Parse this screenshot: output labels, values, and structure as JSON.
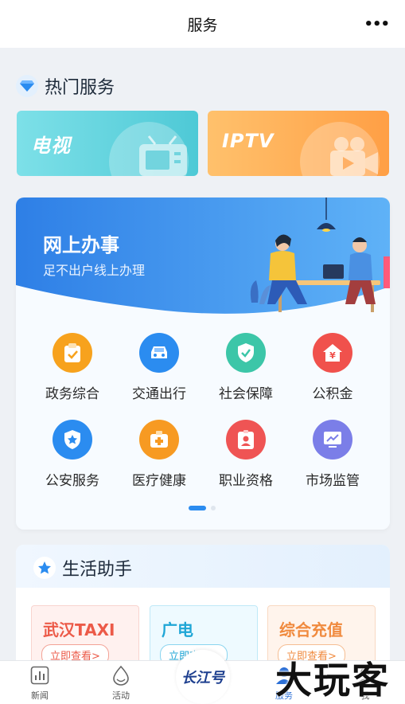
{
  "header": {
    "title": "服务",
    "more": "•••"
  },
  "hot": {
    "title": "热门服务",
    "cards": [
      {
        "label": "电视",
        "color": "#4ec9d6"
      },
      {
        "label": "IPTV",
        "color": "#ff9f45"
      }
    ]
  },
  "online": {
    "title": "网上办事",
    "subtitle": "足不出户线上办理",
    "items": [
      {
        "label": "政务综合",
        "icon": "clipboard-check-icon",
        "color": "#f7a21d"
      },
      {
        "label": "交通出行",
        "icon": "car-icon",
        "color": "#2b8cf0"
      },
      {
        "label": "社会保障",
        "icon": "shield-check-icon",
        "color": "#3cc6a8"
      },
      {
        "label": "公积金",
        "icon": "house-yen-icon",
        "color": "#f0514c"
      },
      {
        "label": "公安服务",
        "icon": "police-badge-icon",
        "color": "#2b8cf0"
      },
      {
        "label": "医疗健康",
        "icon": "medical-kit-icon",
        "color": "#f79a22"
      },
      {
        "label": "职业资格",
        "icon": "id-card-icon",
        "color": "#ef5454"
      },
      {
        "label": "市场监管",
        "icon": "monitor-chart-icon",
        "color": "#7b7ee8"
      }
    ],
    "pager": {
      "current": 1,
      "total": 2
    }
  },
  "life": {
    "title": "生活助手",
    "cards": [
      {
        "title": "武汉TAXI",
        "button": "立即查看>"
      },
      {
        "title": "广电",
        "button": "立即查看>"
      },
      {
        "title": "综合充值",
        "button": "立即查看>"
      }
    ]
  },
  "tabbar": {
    "tabs": [
      {
        "label": "新闻",
        "icon": "news-chart-icon"
      },
      {
        "label": "活动",
        "icon": "activity-drop-icon"
      },
      {
        "label": "服务",
        "icon": "service-icon",
        "active": true
      },
      {
        "label": "我",
        "icon": "profile-icon"
      }
    ],
    "center_logo": "长江号"
  },
  "watermark": "大玩客",
  "colors": {
    "accent": "#2b8cf0",
    "background": "#eef1f5"
  }
}
